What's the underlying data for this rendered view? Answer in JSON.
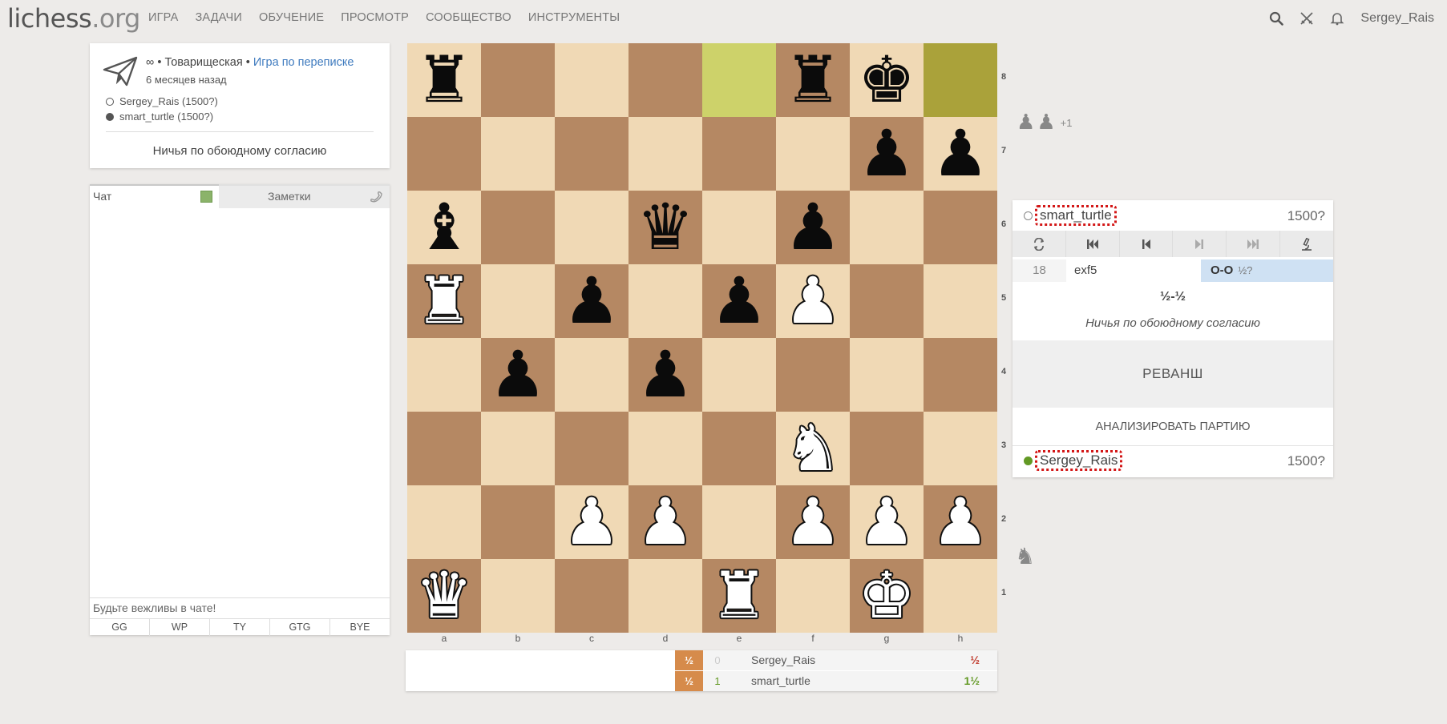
{
  "header": {
    "logo_main": "lichess",
    "logo_tld": ".org",
    "nav": [
      "ИГРА",
      "ЗАДАЧИ",
      "ОБУЧЕНИЕ",
      "ПРОСМОТР",
      "СООБЩЕСТВО",
      "ИНСТРУМЕНТЫ"
    ],
    "username": "Sergey_Rais"
  },
  "game_info": {
    "speed": "∞ • Товарищеская •",
    "mode_link": "Игра по переписке",
    "time_ago": "6 месяцев назад",
    "white_player": "Sergey_Rais (1500?)",
    "black_player": "smart_turtle (1500?)",
    "status": "Ничья по обоюдному согласию"
  },
  "chat": {
    "tab_chat": "Чат",
    "tab_notes": "Заметки",
    "input_placeholder": "Будьте вежливы в чате!",
    "presets": [
      "GG",
      "WP",
      "TY",
      "GTG",
      "BYE"
    ]
  },
  "board": {
    "highlight_squares": [
      "e8",
      "h8"
    ],
    "squares": [
      [
        "br",
        "",
        "",
        "",
        "",
        "br",
        "bk",
        ""
      ],
      [
        "",
        "",
        "",
        "",
        "",
        "",
        "bp",
        "bp"
      ],
      [
        "bb",
        "",
        "",
        "bq",
        "",
        "bp",
        "",
        ""
      ],
      [
        "wr",
        "",
        "bp",
        "",
        "bp",
        "wp",
        "",
        ""
      ],
      [
        "",
        "bp",
        "",
        "bp",
        "",
        "",
        "",
        ""
      ],
      [
        "",
        "",
        "",
        "",
        "",
        "wn",
        "",
        ""
      ],
      [
        "",
        "",
        "wp",
        "wp",
        "",
        "wp",
        "wp",
        "wp"
      ],
      [
        "wq",
        "",
        "",
        "",
        "wr",
        "",
        "wk",
        ""
      ]
    ],
    "files": [
      "a",
      "b",
      "c",
      "d",
      "e",
      "f",
      "g",
      "h"
    ],
    "ranks": [
      "8",
      "7",
      "6",
      "5",
      "4",
      "3",
      "2",
      "1"
    ]
  },
  "score_table": [
    {
      "box": "½",
      "num": "0",
      "num_color": "#cccccc",
      "name": "Sergey_Rais",
      "total": "½",
      "total_color": "#c0392b"
    },
    {
      "box": "½",
      "num": "1",
      "num_color": "#629924",
      "name": "smart_turtle",
      "total": "1½",
      "total_color": "#629924"
    }
  ],
  "material": {
    "top_extra": "+1"
  },
  "right_panel": {
    "top_player": {
      "name": "smart_turtle",
      "rating": "1500?"
    },
    "bottom_player": {
      "name": "Sergey_Rais",
      "rating": "1500?"
    },
    "move_index": "18",
    "white_move": "exf5",
    "black_move": "O-O",
    "black_eval": "½?",
    "result": "½-½",
    "result_status": "Ничья по обоюдному согласию",
    "rematch": "РЕВАНШ",
    "analyse": "АНАЛИЗИРОВАТЬ ПАРТИЮ"
  }
}
